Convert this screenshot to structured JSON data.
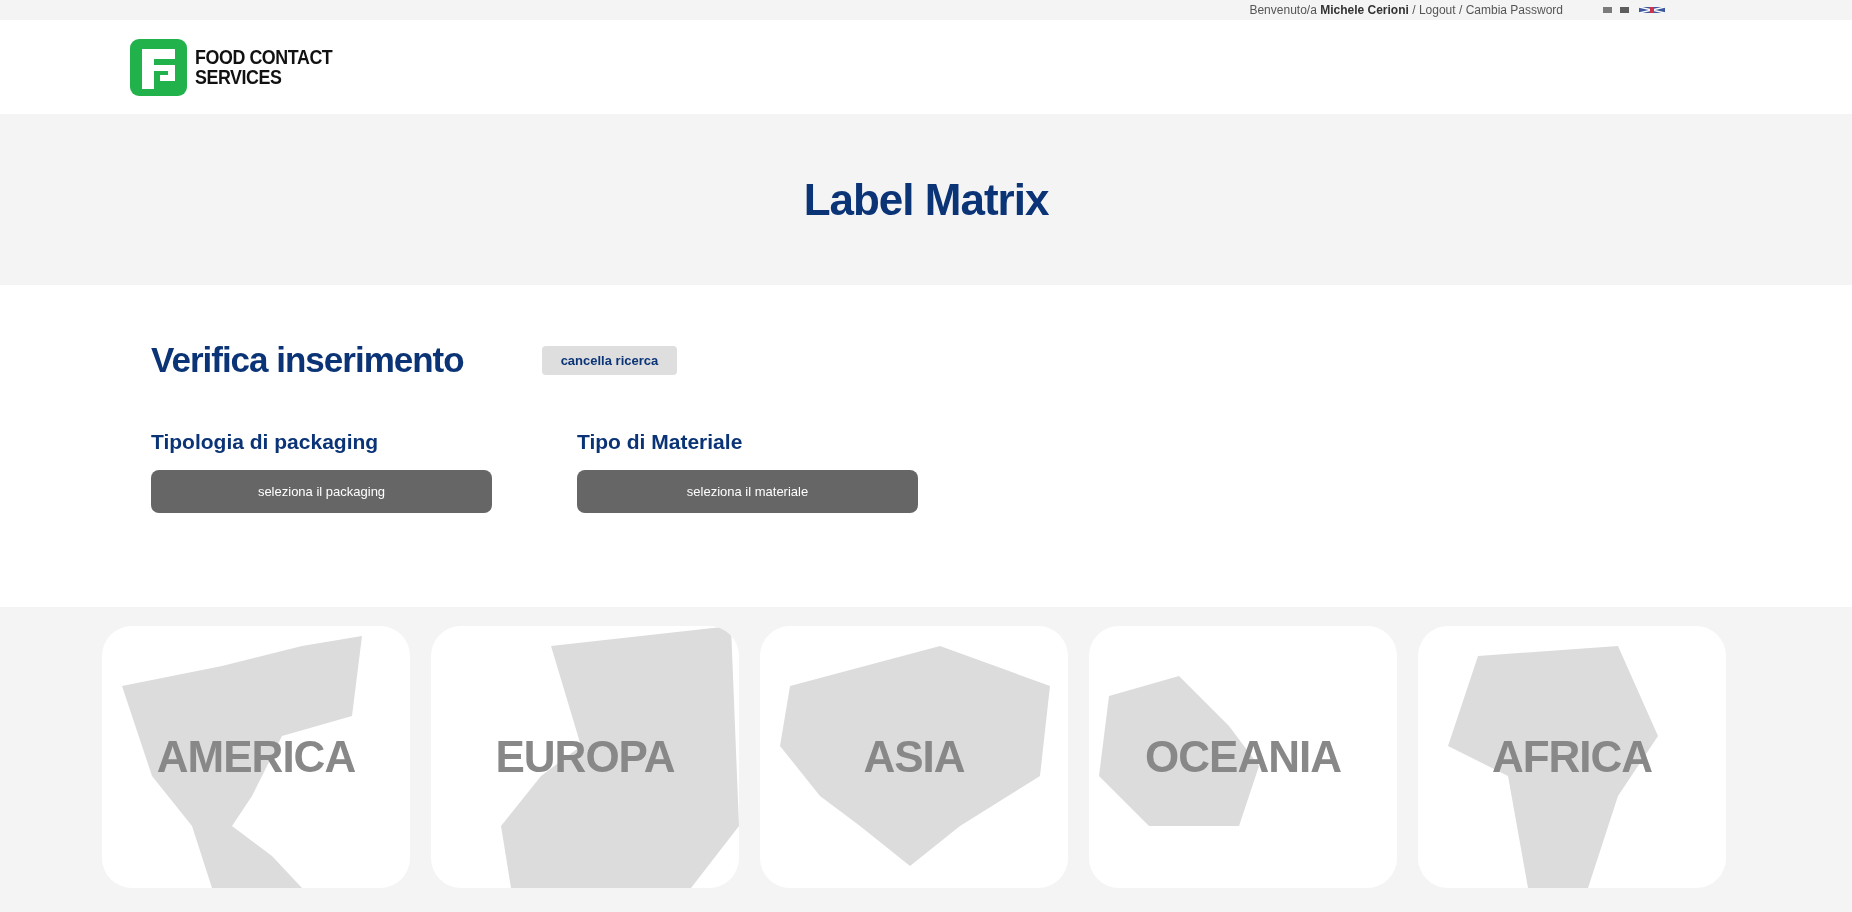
{
  "top_bar": {
    "greeting": "Benvenuto/a",
    "user": "Michele Cerioni",
    "separator": "/",
    "links": [
      "Logout",
      "Cambia Password"
    ],
    "languages": [
      {
        "kind": "italian",
        "selected": false
      },
      {
        "kind": "english",
        "selected": false
      }
    ]
  },
  "logo": {
    "line_1": "FOOD CONTACT",
    "line_2": "SERVICES"
  },
  "hero": {
    "title": "Label Matrix"
  },
  "search": {
    "title": "Verifica inserimento",
    "clear_button": "cancella ricerca",
    "filters": [
      {
        "label": "Tipologia di packaging",
        "button": "seleziona il packaging"
      },
      {
        "label": "Tipo di Materiale",
        "button": "seleziona il materiale"
      }
    ]
  },
  "regions": [
    {
      "kind": "america",
      "label": "AMERICA"
    },
    {
      "kind": "europe",
      "label": "EUROPA"
    },
    {
      "kind": "asia",
      "label": "ASIA"
    },
    {
      "kind": "oceania",
      "label": "OCEANIA"
    },
    {
      "kind": "africa",
      "label": "AFRICA"
    }
  ]
}
